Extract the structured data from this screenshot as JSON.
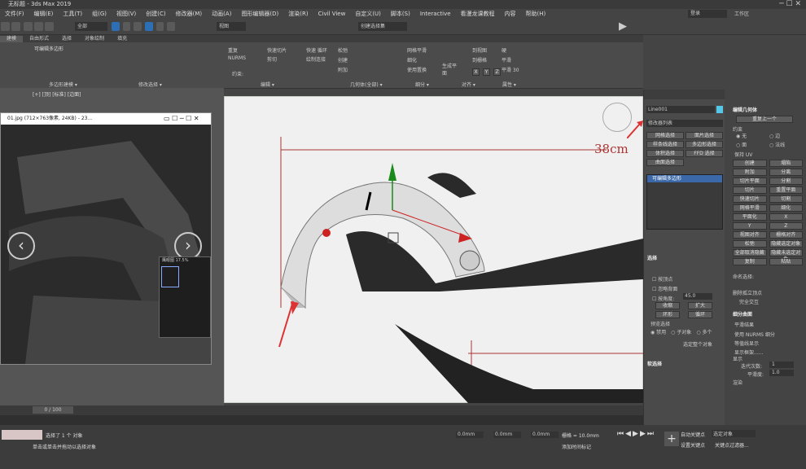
{
  "window": {
    "title": "无标题 - 3ds Max 2019",
    "workspace": "工作区"
  },
  "menu": [
    "文件(F)",
    "编辑(E)",
    "工具(T)",
    "组(G)",
    "视图(V)",
    "创建(C)",
    "修改器(M)",
    "动画(A)",
    "图形编辑器(D)",
    "渲染(R)",
    "Civil View",
    "自定义(U)",
    "脚本(S)",
    "Interactive",
    "看漫龙课教程",
    "内容",
    "帮助(H)"
  ],
  "user": "登录",
  "toolbar": {
    "filter": "全部",
    "refcoord": "视图",
    "selset": "创建选择集"
  },
  "ribbon": {
    "tabs": [
      "建模",
      "自由形式",
      "选择",
      "对象绘制",
      "填充"
    ],
    "edit_poly": "可编辑多边形",
    "panels": [
      "多边形建模",
      "修改选择",
      "编辑",
      "几何体(全部)",
      "细分",
      "对齐",
      "属性"
    ],
    "edit_items": [
      "重复",
      "快速切片",
      "快速 循环",
      "NURMS",
      "剪切",
      "绘制连接"
    ],
    "geom_items": [
      "松弛",
      "创建",
      "附加"
    ],
    "sub_items": [
      "网格平滑",
      "细化",
      "使用置换"
    ],
    "gen": "生成平面",
    "align_items": [
      "到视图",
      "到栅格"
    ],
    "xyz": [
      "X",
      "Y",
      "Z"
    ],
    "prop_items": [
      "硬",
      "平滑",
      "平滑 30"
    ],
    "constraint": "约束:"
  },
  "viewport": {
    "label": "[+] [顶] [标准] [边面]",
    "dimension": "38cm"
  },
  "image_window": {
    "title": "01.jpg (712×763像素, 24KB) - 23...",
    "thumb_label": "鹰眼图 17.5%"
  },
  "cmd": {
    "object_name": "Line001",
    "modifier_list": "修改器列表",
    "stack_item": "可编辑多边形",
    "buttons": [
      "网格选择",
      "面片选择",
      "样条线选择",
      "多边形选择",
      "体积选择",
      "FFD 选择",
      "曲面选择"
    ],
    "selection_title": "选择",
    "sel_opts": [
      "按顶点",
      "忽略背面",
      "按角度:"
    ],
    "angle": "45.0",
    "sel_btns": [
      "收缩",
      "扩大",
      "环形",
      "循环"
    ],
    "preview": "预览选择",
    "preview_opts": [
      "禁用",
      "子对象",
      "多个"
    ],
    "sel_status": "选定整个对象",
    "soft": "软选择"
  },
  "right": {
    "edit_geom": "编辑几何体",
    "repeat": "重复上一个",
    "constraints": "约束",
    "con_opts": [
      "无",
      "边",
      "面",
      "法线"
    ],
    "keep_uv": "保持 UV",
    "btns": [
      "创建",
      "塌陷",
      "附加",
      "分离",
      "切片平面",
      "分割",
      "切片",
      "重置平面",
      "快速切片",
      "切割",
      "网格平滑",
      "细化",
      "平面化",
      "X",
      "Y",
      "Z",
      "视图对齐",
      "栅格对齐",
      "松弛",
      "隐藏选定对象",
      "全部取消隐藏",
      "隐藏未选定对象",
      "复制",
      "粘贴"
    ],
    "named_sel": "命名选择:",
    "delete_iso": "删除孤立顶点",
    "full_inter": "完全交互",
    "subdiv": "细分曲面",
    "smooth_res": "平滑结果",
    "use_nurms": "使用 NURMS 细分",
    "iso_display": "等值线显示",
    "show_cage": "显示框架......",
    "display": "显示",
    "iter": "迭代次数:",
    "iter_val": "1",
    "smooth": "平滑度:",
    "smooth_val": "1.0",
    "render": "渲染"
  },
  "status": {
    "selected": "选择了 1 个 对象",
    "hint": "单击或单击并拖动以选择对象",
    "frame": "0 / 100",
    "x": "0.0mm",
    "y": "0.0mm",
    "z": "0.0mm",
    "grid": "栅格 = 10.0mm",
    "addkey": "添加时间标记",
    "autokey": "自动关键点",
    "setkey": "设置关键点",
    "selobj": "选定对象",
    "keyfilter": "关键点过滤器..."
  }
}
